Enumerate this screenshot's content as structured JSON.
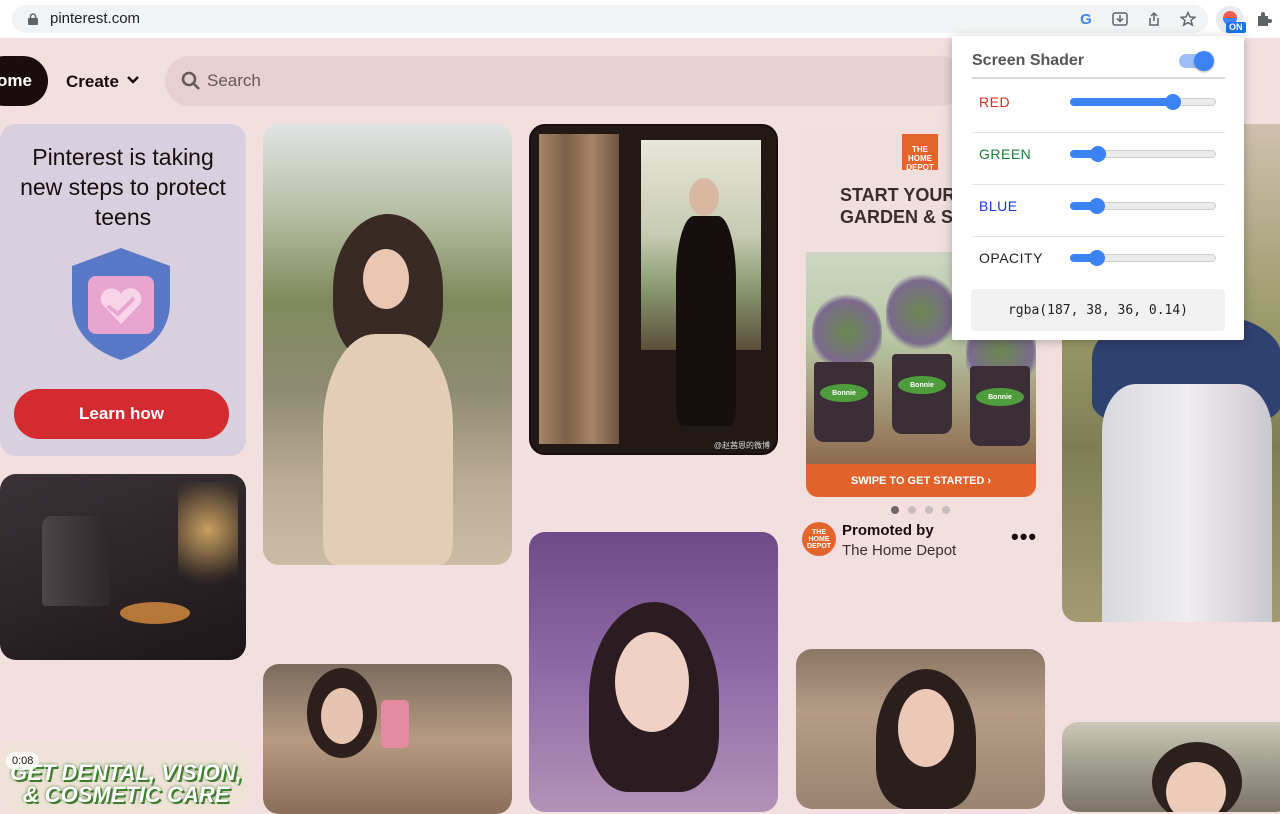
{
  "browser": {
    "url": "pinterest.com",
    "extension_badge": "ON",
    "google_letter": "G"
  },
  "header": {
    "home_label": "ome",
    "create_label": "Create",
    "search_placeholder": "Search"
  },
  "pins": {
    "teens": {
      "title": "Pinterest is taking new steps to protect teens",
      "button_label": "Learn how"
    },
    "window_watermark": "@赵茜恩的微博",
    "home_depot": {
      "logo_text": "THE HOME DEPOT",
      "headline": "START YOUR E GARDEN & S",
      "pot_label": "Bonnie",
      "footer": "SWIPE TO GET STARTED ›",
      "carousel_active_index": 0,
      "carousel_count": 4,
      "promoted_by_label": "Promoted by",
      "advertiser": "The Home Depot",
      "more_label": "•••"
    },
    "dental": {
      "text": "GET DENTAL, VISION, & COSMETIC CARE",
      "video_time": "0:08"
    }
  },
  "screen_shader": {
    "title": "Screen Shader",
    "enabled": true,
    "sliders": [
      {
        "label": "RED",
        "color": "#d93025",
        "value": 187,
        "max": 255
      },
      {
        "label": "GREEN",
        "color": "#188038",
        "value": 38,
        "max": 255
      },
      {
        "label": "BLUE",
        "color": "#1a35d9",
        "value": 36,
        "max": 255
      },
      {
        "label": "OPACITY",
        "color": "#222222",
        "value": 0.14,
        "max": 1
      }
    ],
    "output": "rgba(187, 38, 36, 0.14)"
  },
  "colors": {
    "accent_blue": "#3b82f6",
    "pinterest_red": "#d32b2f",
    "home_depot_orange": "#e3652c",
    "page_tint": "#f3dfe0"
  }
}
